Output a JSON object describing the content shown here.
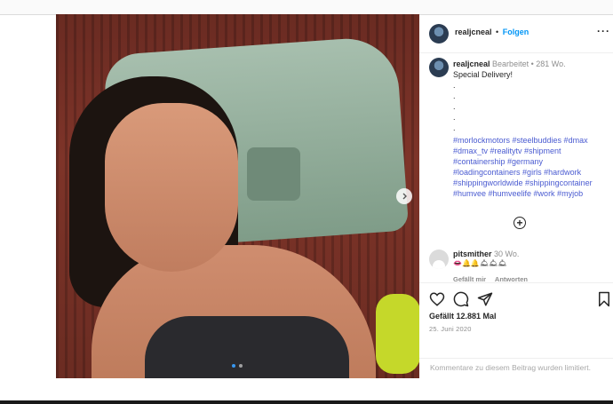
{
  "post": {
    "username": "realjcneal",
    "follow_label": "Folgen",
    "more_label": "···",
    "caption": {
      "username": "realjcneal",
      "edited_label": "Bearbeitet",
      "age": "281 Wo.",
      "text": "Special Delivery!",
      "dots": [
        ".",
        ".",
        ".",
        ".",
        "."
      ],
      "hashtags": [
        "#morlockmotors #steelbuddies #dmax",
        "#dmax_tv #realitytv #shipment",
        "#containership #germany",
        "#loadingcontainers #girls #hardwork",
        "#shippingworldwide #shippingcontainer",
        "#humvee #humveelife #work #myjob"
      ],
      "more_comments_icon": "plus-circle-icon"
    },
    "comment": {
      "username": "pitsmither",
      "age": "30 Wo.",
      "emoji": "👄🔔🔔🛎🛎🛎",
      "likes_label": "Gefällt mir",
      "reply_label": "Antworten"
    },
    "likes": "Gefällt 12.881 Mal",
    "date": "25. Juni 2020",
    "comments_limited": "Kommentare zu diesem Beitrag wurden limitiert.",
    "carousel": {
      "slides": 2,
      "active": 1
    }
  },
  "colors": {
    "accent": "#0095f6",
    "hashtag": "#4a5bd1",
    "muted": "#8e8e8e"
  }
}
